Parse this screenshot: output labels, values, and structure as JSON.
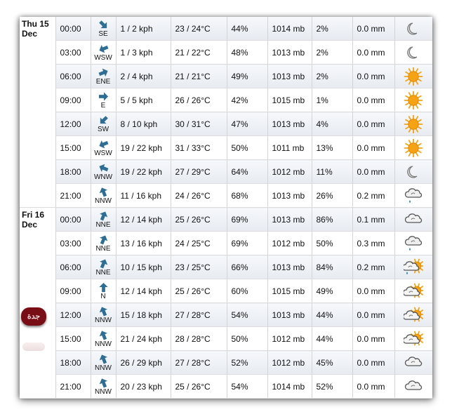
{
  "colors": {
    "arrow": "#2e6e94",
    "sun": "#f5a214",
    "moon": "#a0a0a0",
    "cloud": "#9a9a9a",
    "rain": "#2f86bd",
    "badge": "#7a0e16"
  },
  "days": [
    {
      "label_line1": "Thu 15",
      "label_line2": "Dec",
      "rows": [
        {
          "time": "00:00",
          "dir": "SE",
          "dir_deg": 315,
          "wind": "1 / 2 kph",
          "temp": "23 / 24°C",
          "humidity": "44%",
          "pressure": "1014 mb",
          "cloud": "2%",
          "precip": "0.0 mm",
          "icon": "moon-icon"
        },
        {
          "time": "03:00",
          "dir": "WSW",
          "dir_deg": 68,
          "wind": "1 / 3 kph",
          "temp": "21 / 22°C",
          "humidity": "48%",
          "pressure": "1013 mb",
          "cloud": "2%",
          "precip": "0.0 mm",
          "icon": "moon-icon"
        },
        {
          "time": "06:00",
          "dir": "ENE",
          "dir_deg": 248,
          "wind": "2 / 4 kph",
          "temp": "21 / 21°C",
          "humidity": "49%",
          "pressure": "1013 mb",
          "cloud": "2%",
          "precip": "0.0 mm",
          "icon": "sun-icon"
        },
        {
          "time": "09:00",
          "dir": "E",
          "dir_deg": 270,
          "wind": "5 / 5 kph",
          "temp": "26 / 26°C",
          "humidity": "42%",
          "pressure": "1015 mb",
          "cloud": "1%",
          "precip": "0.0 mm",
          "icon": "sun-icon"
        },
        {
          "time": "12:00",
          "dir": "SW",
          "dir_deg": 45,
          "wind": "8 / 10 kph",
          "temp": "30 / 31°C",
          "humidity": "47%",
          "pressure": "1013 mb",
          "cloud": "4%",
          "precip": "0.0 mm",
          "icon": "sun-icon"
        },
        {
          "time": "15:00",
          "dir": "WSW",
          "dir_deg": 68,
          "wind": "19 / 22 kph",
          "temp": "31 / 33°C",
          "humidity": "50%",
          "pressure": "1011 mb",
          "cloud": "13%",
          "precip": "0.0 mm",
          "icon": "sun-icon"
        },
        {
          "time": "18:00",
          "dir": "WNW",
          "dir_deg": 113,
          "wind": "19 / 22 kph",
          "temp": "27 / 29°C",
          "humidity": "64%",
          "pressure": "1012 mb",
          "cloud": "11%",
          "precip": "0.0 mm",
          "icon": "moon-icon"
        },
        {
          "time": "21:00",
          "dir": "NNW",
          "dir_deg": 158,
          "wind": "11 / 16 kph",
          "temp": "24 / 26°C",
          "humidity": "68%",
          "pressure": "1013 mb",
          "cloud": "26%",
          "precip": "0.2 mm",
          "icon": "cloud-rain-icon"
        }
      ]
    },
    {
      "label_line1": "Fri 16",
      "label_line2": "Dec",
      "badge_text": "جدة",
      "rows": [
        {
          "time": "00:00",
          "dir": "NNE",
          "dir_deg": 203,
          "wind": "12 / 14 kph",
          "temp": "25 / 26°C",
          "humidity": "69%",
          "pressure": "1013 mb",
          "cloud": "86%",
          "precip": "0.1 mm",
          "icon": "cloud-icon"
        },
        {
          "time": "03:00",
          "dir": "NNE",
          "dir_deg": 203,
          "wind": "13 / 16 kph",
          "temp": "24 / 25°C",
          "humidity": "69%",
          "pressure": "1012 mb",
          "cloud": "50%",
          "precip": "0.3 mm",
          "icon": "cloud-rain-icon"
        },
        {
          "time": "06:00",
          "dir": "NNE",
          "dir_deg": 203,
          "wind": "10 / 15 kph",
          "temp": "23 / 25°C",
          "humidity": "66%",
          "pressure": "1013 mb",
          "cloud": "84%",
          "precip": "0.2 mm",
          "icon": "sun-cloud-rain-icon"
        },
        {
          "time": "09:00",
          "dir": "N",
          "dir_deg": 180,
          "wind": "12 / 14 kph",
          "temp": "25 / 26°C",
          "humidity": "60%",
          "pressure": "1015 mb",
          "cloud": "49%",
          "precip": "0.0 mm",
          "icon": "sun-cloud-icon"
        },
        {
          "time": "12:00",
          "dir": "NNW",
          "dir_deg": 158,
          "wind": "15 / 18 kph",
          "temp": "27 / 28°C",
          "humidity": "54%",
          "pressure": "1013 mb",
          "cloud": "44%",
          "precip": "0.0 mm",
          "icon": "sun-cloud-icon"
        },
        {
          "time": "15:00",
          "dir": "NNW",
          "dir_deg": 158,
          "wind": "21 / 24 kph",
          "temp": "28 / 28°C",
          "humidity": "50%",
          "pressure": "1012 mb",
          "cloud": "44%",
          "precip": "0.0 mm",
          "icon": "sun-cloud-icon"
        },
        {
          "time": "18:00",
          "dir": "NNW",
          "dir_deg": 158,
          "wind": "26 / 29 kph",
          "temp": "27 / 28°C",
          "humidity": "52%",
          "pressure": "1012 mb",
          "cloud": "45%",
          "precip": "0.0 mm",
          "icon": "cloud-icon"
        },
        {
          "time": "21:00",
          "dir": "NNW",
          "dir_deg": 158,
          "wind": "20 / 23 kph",
          "temp": "25 / 26°C",
          "humidity": "54%",
          "pressure": "1014 mb",
          "cloud": "52%",
          "precip": "0.0 mm",
          "icon": "cloud-icon"
        }
      ]
    }
  ]
}
